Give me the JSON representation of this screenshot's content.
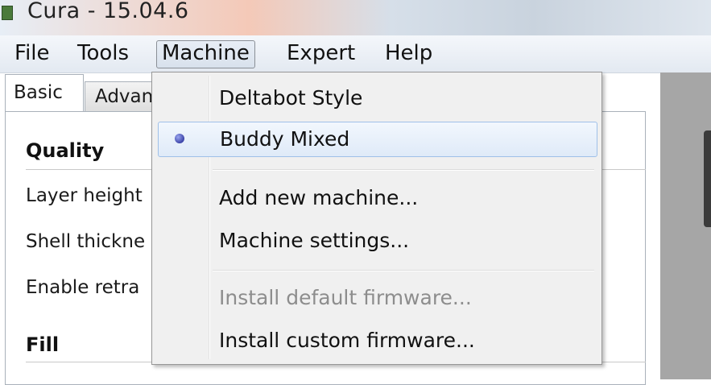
{
  "window": {
    "title": "Cura - 15.04.6"
  },
  "menubar": {
    "items": [
      "File",
      "Tools",
      "Machine",
      "Expert",
      "Help"
    ],
    "active": "Machine"
  },
  "tabs": [
    {
      "label": "Basic"
    },
    {
      "label": "Advan"
    }
  ],
  "panel": {
    "quality_heading": "Quality",
    "quality_settings": [
      "Layer height",
      "Shell thickne",
      "Enable retra"
    ],
    "fill_heading": "Fill"
  },
  "machine_menu": {
    "items": [
      {
        "label": "Deltabot Style",
        "selected": false,
        "enabled": true
      },
      {
        "label": "Buddy  Mixed",
        "selected": true,
        "enabled": true
      },
      {
        "label": "Add new machine...",
        "selected": false,
        "enabled": true
      },
      {
        "label": "Machine settings...",
        "selected": false,
        "enabled": true
      },
      {
        "label": "Install default firmware...",
        "selected": false,
        "enabled": false
      },
      {
        "label": "Install custom firmware...",
        "selected": false,
        "enabled": true
      }
    ]
  },
  "colors": {
    "selection_border": "#9fc0e8",
    "radio_dot": "#3c44a8",
    "disabled_text": "#8d8d8d"
  }
}
